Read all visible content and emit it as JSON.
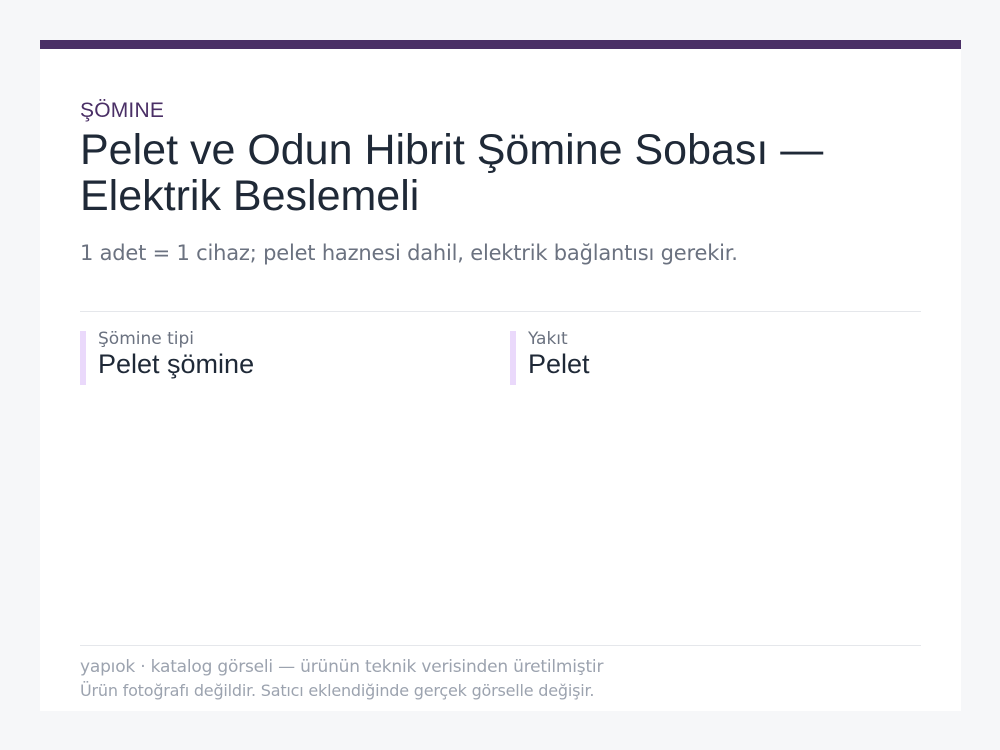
{
  "product": {
    "category": "ŞÖMINE",
    "title": "Pelet ve Odun Hibrit Şömine Sobası — Elektrik Beslemeli",
    "subtitle": "1 adet = 1 cihaz; pelet haznesi dahil, elektrik bağlantısı gerekir."
  },
  "specs": [
    {
      "label": "Şömine tipi",
      "value": "Pelet şömine"
    },
    {
      "label": "Yakıt",
      "value": "Pelet"
    }
  ],
  "footer": {
    "line1": "yapıok · katalog görseli — ürünün teknik verisinden üretilmiştir",
    "line2": "Ürün fotoğrafı değildir. Satıcı eklendiğinde gerçek görselle değişir."
  },
  "colors": {
    "accent": "#4a2f66",
    "spec_marker": "#ead9fb",
    "title_text": "#1f2937",
    "muted_text": "#6b7280",
    "footer_text": "#9ca3af"
  }
}
